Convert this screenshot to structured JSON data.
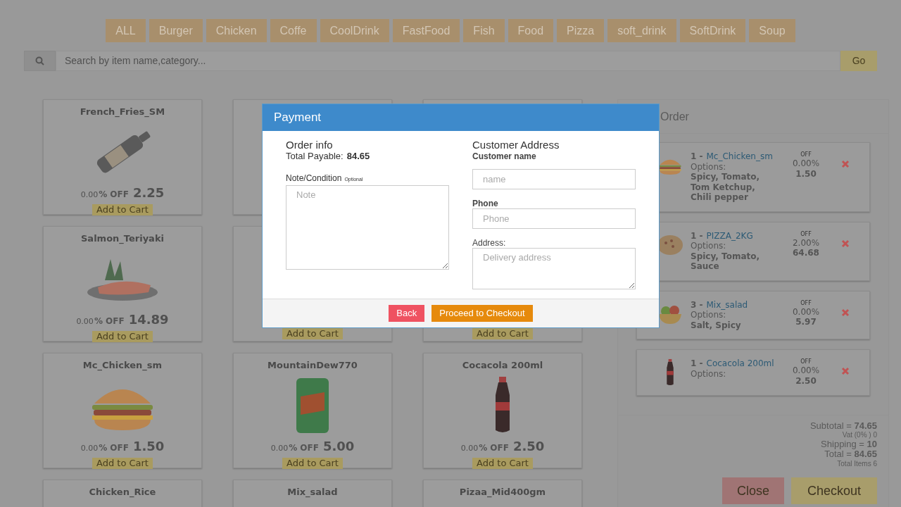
{
  "categories": [
    {
      "label": "ALL"
    },
    {
      "label": "Burger"
    },
    {
      "label": "Chicken"
    },
    {
      "label": "Coffe"
    },
    {
      "label": "CoolDrink"
    },
    {
      "label": "FastFood"
    },
    {
      "label": "Fish"
    },
    {
      "label": "Food"
    },
    {
      "label": "Pizza"
    },
    {
      "label": "soft_drink"
    },
    {
      "label": "SoftDrink"
    },
    {
      "label": "Soup"
    }
  ],
  "search": {
    "placeholder": "Search by item name,category...",
    "button": "Go"
  },
  "products": [
    {
      "kind": "fries",
      "name": "French_Fries_SM",
      "discount": "0.00",
      "off": "% OFF",
      "price": "2.25",
      "button": "Add to Cart"
    },
    {
      "kind": "covered"
    },
    {
      "kind": "covered"
    },
    {
      "kind": "salmon",
      "name": "Salmon_Teriyaki",
      "discount": "0.00",
      "off": "% OFF",
      "price": "14.89",
      "button": "Add to Cart"
    },
    {
      "kind": "covered",
      "button": "Add to Cart"
    },
    {
      "kind": "covered",
      "button": "Add to Cart"
    },
    {
      "kind": "burger",
      "name": "Mc_Chicken_sm",
      "discount": "0.00",
      "off": "% OFF",
      "price": "1.50",
      "button": "Add to Cart"
    },
    {
      "kind": "can",
      "name": "MountainDew770",
      "discount": "0.00",
      "off": "% OFF",
      "price": "5.00",
      "button": "Add to Cart"
    },
    {
      "kind": "cola",
      "name": "Cocacola 200ml",
      "discount": "0.00",
      "off": "% OFF",
      "price": "2.50",
      "button": "Add to Cart"
    },
    {
      "kind": "item",
      "name": "Chicken_Rice"
    },
    {
      "kind": "item",
      "name": "Mix_salad"
    },
    {
      "kind": "item",
      "name": "Pizaa_Mid400gm"
    }
  ],
  "cart": {
    "title": "Order",
    "items": [
      {
        "kind": "burger",
        "qty": "1 -",
        "name": "Mc_Chicken_sm",
        "options_label": "Options:",
        "options": "Spicy, Tomato, Tom Ketchup, Chili pepper",
        "off": "OFF",
        "discount": "0.00",
        "percent": "%",
        "price": "1.50"
      },
      {
        "kind": "pizza",
        "qty": "1 -",
        "name": "PIZZA_2KG",
        "options_label": "Options:",
        "options": "Spicy, Tomato, Sauce",
        "off": "OFF",
        "discount": "2.00",
        "percent": "%",
        "price": "64.68"
      },
      {
        "kind": "salad",
        "qty": "3 -",
        "name": "Mix_salad",
        "options_label": "Options:",
        "options": "Salt, Spicy",
        "off": "OFF",
        "discount": "0.00",
        "percent": "%",
        "price": "5.97"
      },
      {
        "kind": "cola",
        "qty": "1 -",
        "name": "Cocacola 200ml",
        "options_label": "Options:",
        "off": "OFF",
        "discount": "0.00",
        "percent": "%",
        "price": "2.50"
      }
    ],
    "subtotal": "Subtotal = **74.65**",
    "vat": "Vat (0% ) 0",
    "shipping": "Shipping = **10**",
    "total": "Total = **84.65**",
    "total_items": "Total Items 6",
    "buttons": [
      "Close",
      "Checkout"
    ]
  },
  "modal": {
    "title": "Payment",
    "order_heading": "Order info",
    "total_label": "Total Payable:",
    "total_value": "84.65",
    "note_label": "Note/Condition",
    "note_hint": "Optional",
    "note_placeholder": "Note",
    "customer_heading": "Customer Address",
    "name_label": "Customer name",
    "name_placeholder": "name",
    "phone_label": "Phone",
    "phone_placeholder": "Phone",
    "address_label": "Address:",
    "address_placeholder": "Delivery address",
    "back": "Back",
    "proceed": "Proceed to Checkout"
  }
}
